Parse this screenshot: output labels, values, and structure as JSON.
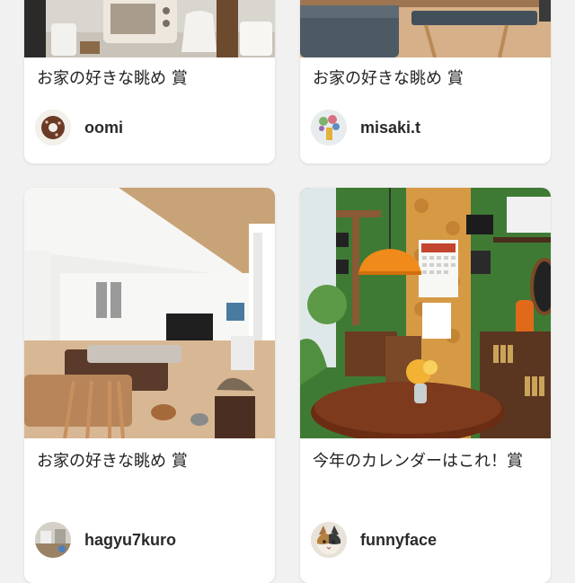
{
  "cards": [
    {
      "title": "お家の好きな眺め 賞",
      "username": "oomi",
      "photo_icon": "kitchen-appliances-photo",
      "avatar_icon": "donut-avatar"
    },
    {
      "title": "お家の好きな眺め 賞",
      "username": "misaki.t",
      "photo_icon": "living-room-sofa-photo",
      "avatar_icon": "flowers-avatar"
    },
    {
      "title": "お家の好きな眺め 賞",
      "username": "hagyu7kuro",
      "photo_icon": "open-living-room-photo",
      "avatar_icon": "room-avatar"
    },
    {
      "title": "今年のカレンダーはこれ！賞",
      "username": "funnyface",
      "photo_icon": "retro-dining-room-photo",
      "avatar_icon": "cat-avatar"
    }
  ],
  "colors": {
    "background": "#f1f1f1",
    "card": "#ffffff",
    "text": "#222222",
    "pendant_lamp": "#f08a1a",
    "green_wall": "#3f7a35"
  }
}
